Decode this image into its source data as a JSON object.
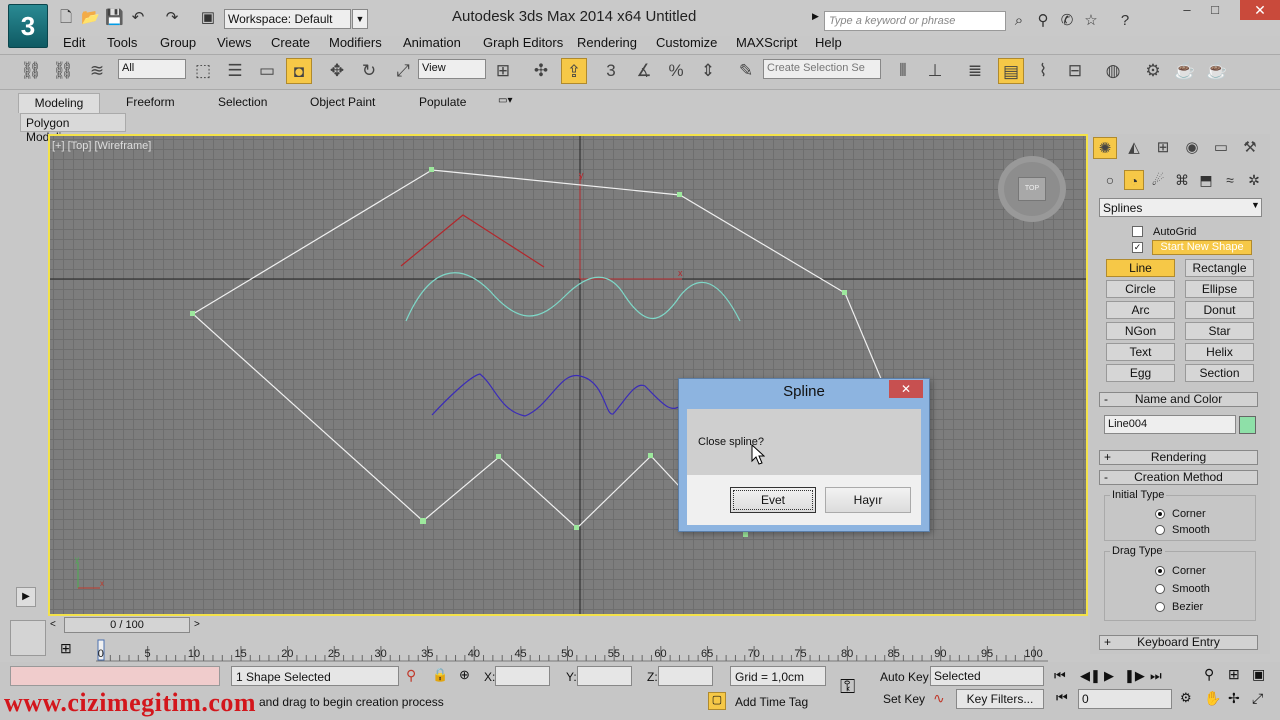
{
  "window": {
    "title": "Autodesk 3ds Max  2014 x64      Untitled",
    "workspace": "Workspace: Default",
    "search_placeholder": "Type a keyword or phrase",
    "logo_letter": "3"
  },
  "menu": [
    "Edit",
    "Tools",
    "Group",
    "Views",
    "Create",
    "Modifiers",
    "Animation",
    "Graph Editors",
    "Rendering",
    "Customize",
    "MAXScript",
    "Help"
  ],
  "toolbar": {
    "filter_value": "All",
    "ref_coord_value": "View",
    "selection_set_placeholder": "Create Selection Se"
  },
  "ribbon": {
    "tabs": [
      "Modeling",
      "Freeform",
      "Selection",
      "Object Paint",
      "Populate"
    ],
    "panel": "Polygon Modeling"
  },
  "viewport": {
    "label": "[+] [Top] [Wireframe]",
    "viewcube_face": "TOP",
    "axis_y": "y",
    "axis_x": "x",
    "colors": {
      "highlight": "#f3e24a",
      "white_spline": "#f0f0f0",
      "red_spline": "#b3262b",
      "cyan_spline": "#7ed8c8",
      "blue_spline": "#3a2bb8"
    }
  },
  "command_panel": {
    "category": "Splines",
    "autogrid": "AutoGrid",
    "start_new_shape": "Start New Shape",
    "object_types": [
      "Line",
      "Rectangle",
      "Circle",
      "Ellipse",
      "Arc",
      "Donut",
      "NGon",
      "Star",
      "Text",
      "Helix",
      "Egg",
      "Section"
    ],
    "name_color_header": "Name and Color",
    "object_name": "Line004",
    "rendering_header": "Rendering",
    "creation_method_header": "Creation Method",
    "initial_type_label": "Initial Type",
    "initial_type_options": [
      "Corner",
      "Smooth"
    ],
    "drag_type_label": "Drag Type",
    "drag_type_options": [
      "Corner",
      "Smooth",
      "Bezier"
    ],
    "keyboard_entry_header": "Keyboard Entry"
  },
  "timeline": {
    "slider": "0 / 100",
    "ticks": [
      "0",
      "5",
      "10",
      "15",
      "20",
      "25",
      "30",
      "35",
      "40",
      "45",
      "50",
      "55",
      "60",
      "65",
      "70",
      "75",
      "80",
      "85",
      "90",
      "95",
      "100"
    ]
  },
  "status": {
    "selection": "1 Shape Selected",
    "prompt": "and drag to begin creation process",
    "x_label": "X:",
    "y_label": "Y:",
    "z_label": "Z:",
    "grid": "Grid = 1,0cm",
    "auto_key": "Auto Key",
    "set_key": "Set Key",
    "key_mode": "Selected",
    "key_filters": "Key Filters...",
    "add_time_tag": "Add Time Tag",
    "frame": "0"
  },
  "watermark": "www.cizimegitim.com",
  "dialog": {
    "title": "Spline",
    "message": "Close spline?",
    "yes_label": "Evet",
    "no_label": "Hayır"
  }
}
